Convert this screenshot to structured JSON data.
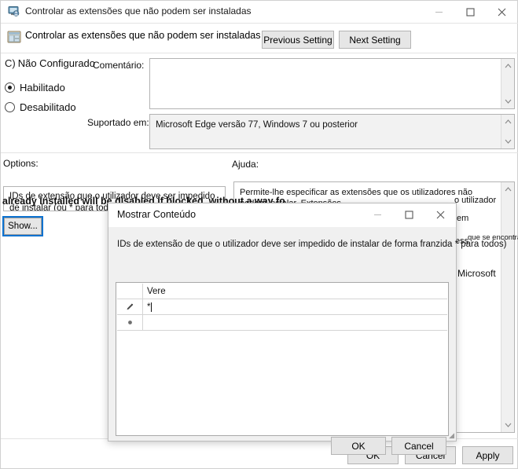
{
  "window": {
    "title": "Controlar as extensões que não podem ser instaladas",
    "icon": "policy-window-icon",
    "controls": {
      "minimize": "–",
      "maximize": "☐",
      "close": "✕"
    }
  },
  "header": {
    "icon": "policy-setting-icon",
    "title": "Controlar as extensões que não podem ser instaladas",
    "previous_label": "Previous Setting",
    "next_label": "Next Setting"
  },
  "state": {
    "not_configured_label": "Não Configurado",
    "not_configured_glyph": "C)",
    "enabled_label": "Habilitado",
    "disabled_label": "Desabilitado",
    "selected": "Habilitado"
  },
  "fields": {
    "comment_label": "Comentário:",
    "comment_value": "",
    "supported_label": "Suportado em:",
    "supported_value": "Microsoft Edge versão 77, Windows 7 ou posterior"
  },
  "options": {
    "label": "Options:",
    "description": "IDs de extensão que o utilizador deve ser impedido de instalar (ou * para todos) ou",
    "show_button": "Show..."
  },
  "help": {
    "label": "Ajuda:",
    "text": "Permite-lhe especificar as extensões que os utilizadores não podem instalar. Extensões",
    "overlay_english": "already installed will be disabled if blocked, without a way fo",
    "fragment_utilizador": "o utilizador",
    "fragment_em": "em",
    "fragment_ess": "ess",
    "fragment_encontra": "que se encontra",
    "fragment_microsoft": "Microsoft"
  },
  "main_buttons": {
    "ok": "OK",
    "cancel": "Cancel",
    "apply": "Apply"
  },
  "modal": {
    "title": "Mostrar Conteúdo",
    "description": "IDs de extensão de que o utilizador deve ser impedido de instalar de forma franzida * para todos)",
    "controls": {
      "minimize": "–",
      "maximize": "☐",
      "close": "✕"
    },
    "grid": {
      "column_header": "Vere",
      "rows": [
        {
          "indicator": "edit-pencil",
          "value": "*"
        },
        {
          "indicator": "new-row",
          "value": ""
        }
      ]
    },
    "buttons": {
      "ok": "OK",
      "cancel": "Cancel"
    },
    "resize_grip": "◢"
  }
}
